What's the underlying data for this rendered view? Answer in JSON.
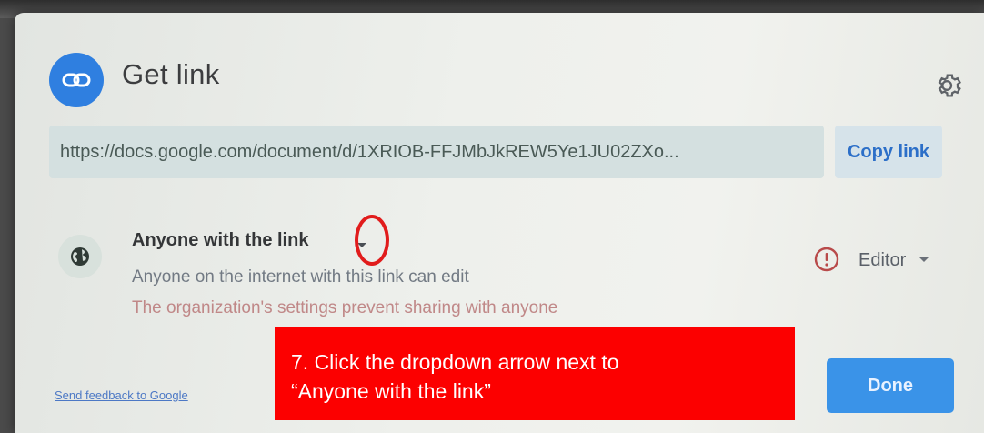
{
  "dialog": {
    "title": "Get link",
    "icons": {
      "title_icon": "link-icon",
      "settings_icon": "gear-icon"
    }
  },
  "link": {
    "url": "https://docs.google.com/document/d/1XRIOB-FFJMbJkREW5Ye1JU02ZXo...",
    "copy_label": "Copy link"
  },
  "access": {
    "icon": "globe-icon",
    "title": "Anyone with the link",
    "description": "Anyone on the internet with this link can edit",
    "warning": "The organization's settings prevent sharing with anyone",
    "role": "Editor",
    "alert_icon": "alert-circle-icon"
  },
  "footer": {
    "feedback_label": "Send feedback to Google",
    "done_label": "Done"
  },
  "annotation": {
    "callout_line1": "7. Click the dropdown arrow next to",
    "callout_line2": "“Anyone with the link”"
  },
  "colors": {
    "accent": "#2f7fe0",
    "done_button": "#3a93e8",
    "callout": "#fc0000",
    "highlight_ring": "#e11c1c"
  }
}
